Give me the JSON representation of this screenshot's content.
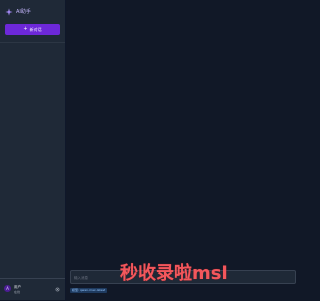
{
  "app": {
    "title": "AI助手",
    "icon": "sparkle-icon",
    "accent_color": "#6d28d9"
  },
  "sidebar": {
    "new_chat_label": "新对话",
    "new_chat_icon": "plus-icon"
  },
  "user": {
    "avatar_initial": "A",
    "name": "用户",
    "status": "在线",
    "settings_icon": "gear-icon"
  },
  "composer": {
    "placeholder": "输入消息",
    "model_tag": "模型: qwen-max-latest"
  },
  "watermark": {
    "text": "秒收录啦msl"
  }
}
